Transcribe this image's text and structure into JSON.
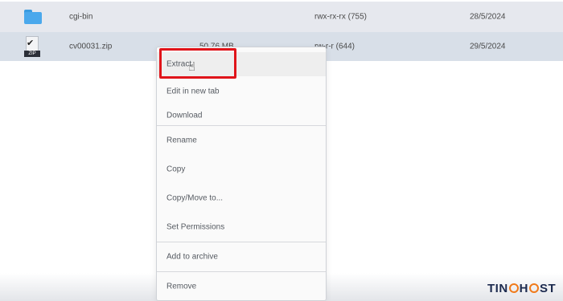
{
  "files": [
    {
      "name": "cgi-bin",
      "size": "",
      "permissions": "rwx-rx-rx (755)",
      "date": "28/5/2024",
      "icon": "folder-icon"
    },
    {
      "name": "cv00031.zip",
      "size": "50.76 MB",
      "permissions": "rw-r-r (644)",
      "date": "29/5/2024",
      "icon": "zip-file-icon",
      "icon_tag": "ZIP"
    }
  ],
  "context_menu": {
    "extract": "Extract",
    "edit_new_tab": "Edit in new tab",
    "download": "Download",
    "rename": "Rename",
    "copy": "Copy",
    "copy_move": "Copy/Move to...",
    "set_permissions": "Set Permissions",
    "add_to_archive": "Add to archive",
    "remove": "Remove"
  },
  "highlight": {
    "target": "Extract",
    "color": "#e0141a"
  },
  "watermark": {
    "part1": "TIN",
    "part2": "H",
    "part3": "ST"
  },
  "colors": {
    "folder": "#4aa8ec",
    "selected_row": "#d8dfe8",
    "accent_orange": "#f07a1a",
    "brand_navy": "#1d2b4f"
  }
}
